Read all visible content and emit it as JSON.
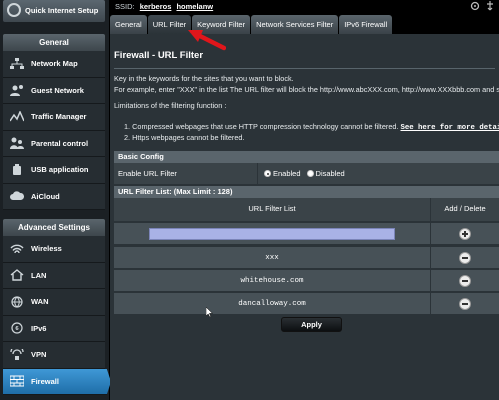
{
  "sidebar": {
    "quick_setup": "Quick Internet Setup",
    "general_title": "General",
    "general_items": [
      {
        "label": "Network Map",
        "icon": "network-map-icon"
      },
      {
        "label": "Guest Network",
        "icon": "guest-network-icon"
      },
      {
        "label": "Traffic Manager",
        "icon": "traffic-manager-icon"
      },
      {
        "label": "Parental control",
        "icon": "parental-control-icon"
      },
      {
        "label": "USB application",
        "icon": "usb-icon"
      },
      {
        "label": "AiCloud",
        "icon": "cloud-icon"
      }
    ],
    "advanced_title": "Advanced Settings",
    "advanced_items": [
      {
        "label": "Wireless",
        "icon": "wifi-icon"
      },
      {
        "label": "LAN",
        "icon": "home-icon"
      },
      {
        "label": "WAN",
        "icon": "globe-icon"
      },
      {
        "label": "IPv6",
        "icon": "ipv6-icon"
      },
      {
        "label": "VPN",
        "icon": "vpn-icon"
      },
      {
        "label": "Firewall",
        "icon": "firewall-icon",
        "active": true
      }
    ]
  },
  "topbar": {
    "ssid_label": "SSID:",
    "ssid_1": "kerberos",
    "ssid_2": "homelanw"
  },
  "tabs": [
    "General",
    "URL Filter",
    "Keyword Filter",
    "Network Services Filter",
    "IPv6 Firewall"
  ],
  "selected_tab": "URL Filter",
  "page": {
    "title": "Firewall - URL Filter",
    "desc1": "Key in the keywords for the sites that you want to block.",
    "desc2": "For example, enter \"XXX\" in the list The URL filter will block the http://www.abcXXX.com, http://www.XXXbbb.com and so on.",
    "limit_title": "Limitations of the filtering function :",
    "limit1": "1.   Compressed webpages that use HTTP compression technology cannot be filtered.",
    "limit1_link": "See here for more details.",
    "limit2": "2.   Https webpages cannot be filtered."
  },
  "basic_config": {
    "header": "Basic Config",
    "enable_label": "Enable URL Filter",
    "opt_enabled": "Enabled",
    "opt_disabled": "Disabled",
    "selected": "Enabled"
  },
  "url_list": {
    "header": "URL Filter List: (Max Limit : 128)",
    "col_list": "URL Filter List",
    "col_action": "Add / Delete",
    "input_value": "",
    "entries": [
      "xxx",
      "whitehouse.com",
      "dancalloway.com"
    ]
  },
  "apply_label": "Apply",
  "colors": {
    "accent": "#2f86c4",
    "panel": "#2b3338",
    "input": "#a9b2e6",
    "arrow": "#e0161b"
  }
}
